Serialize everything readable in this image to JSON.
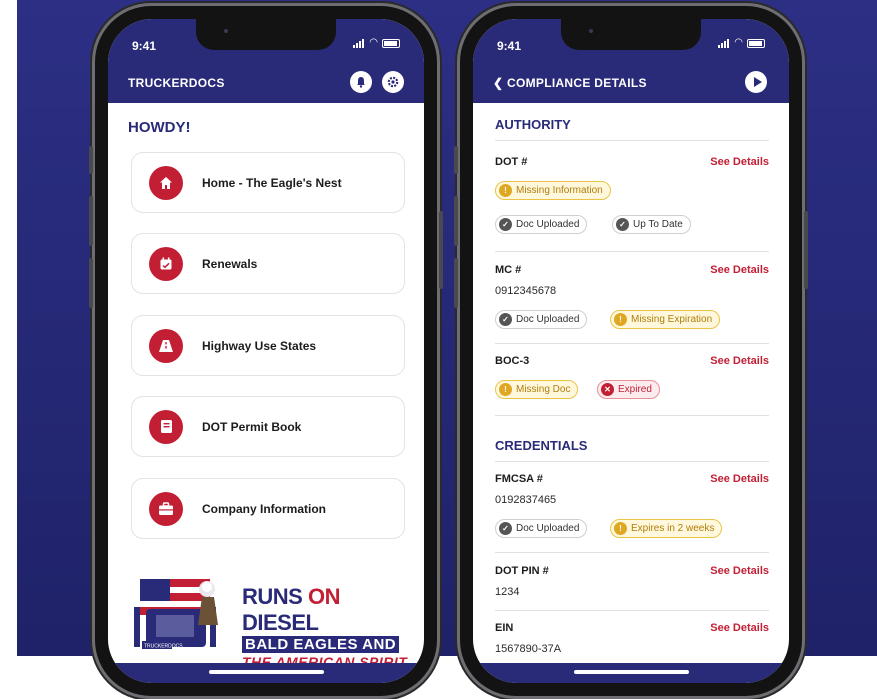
{
  "status": {
    "time": "9:41"
  },
  "home": {
    "app_title": "TRUCKERDOCS",
    "greeting": "HOWDY!",
    "menu": [
      {
        "label": "Home - The Eagle's Nest",
        "icon": "house-icon"
      },
      {
        "label": "Renewals",
        "icon": "calendar-check-icon"
      },
      {
        "label": "Highway Use States",
        "icon": "road-icon"
      },
      {
        "label": "DOT Permit Book",
        "icon": "book-icon"
      },
      {
        "label": "Company Information",
        "icon": "briefcase-icon"
      }
    ],
    "logo": {
      "line1_a": "RUNS ",
      "line1_b": "ON",
      "line1_c": " DIESEL",
      "line2": "BALD EAGLES AND",
      "line3": "THE AMERICAN SPIRIT",
      "truck_tag": "TRUCKERDOCS"
    }
  },
  "details": {
    "title": "COMPLIANCE DETAILS",
    "see_details": "See Details",
    "sections": {
      "authority": "AUTHORITY",
      "credentials": "CREDENTIALS"
    },
    "items": {
      "dot": {
        "label": "DOT #",
        "badges": [
          "Missing Information",
          "Doc Uploaded",
          "Up To Date"
        ]
      },
      "mc": {
        "label": "MC #",
        "value": "0912345678",
        "badges": [
          "Doc Uploaded",
          "Missing Expiration"
        ]
      },
      "boc": {
        "label": "BOC-3",
        "badges": [
          "Missing Doc",
          "Expired"
        ]
      },
      "fmcsa": {
        "label": "FMCSA #",
        "value": "0192837465",
        "badges": [
          "Doc Uploaded",
          "Expires in 2 weeks"
        ]
      },
      "dotpin": {
        "label": "DOT PIN #",
        "value": "1234"
      },
      "ein": {
        "label": "EIN",
        "value": "1567890-37A"
      }
    }
  },
  "colors": {
    "brand_navy": "#2a2b78",
    "brand_red": "#c21f35",
    "warning": "#e0a822"
  }
}
